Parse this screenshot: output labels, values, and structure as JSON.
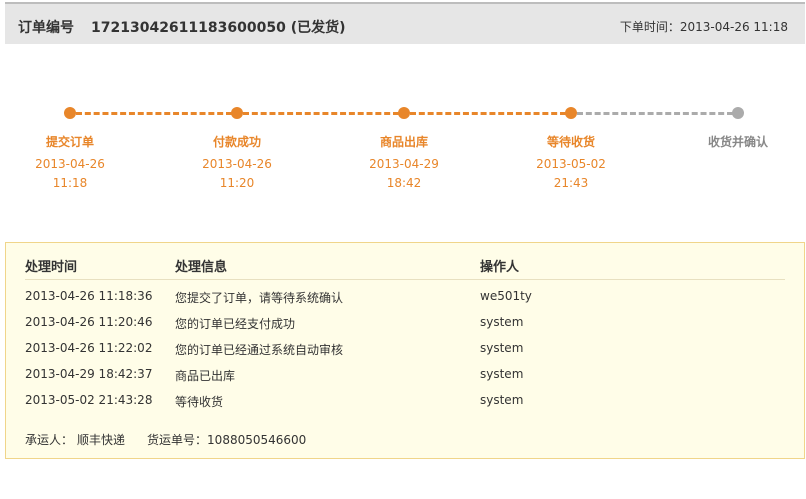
{
  "header": {
    "order_label": "订单编号",
    "order_number": "17213042611183600050",
    "order_status": "(已发货)",
    "order_time_label": "下单时间：",
    "order_time": "2013-04-26 11:18"
  },
  "progress": {
    "steps": [
      {
        "label": "提交订单",
        "date": "2013-04-26",
        "time": "11:18",
        "done": true
      },
      {
        "label": "付款成功",
        "date": "2013-04-26",
        "time": "11:20",
        "done": true
      },
      {
        "label": "商品出库",
        "date": "2013-04-29",
        "time": "18:42",
        "done": true
      },
      {
        "label": "等待收货",
        "date": "2013-05-02",
        "time": "21:43",
        "done": true
      },
      {
        "label": "收货并确认",
        "date": "",
        "time": "",
        "done": false
      }
    ],
    "colors": {
      "done": "#e8862a",
      "pending": "#ababab"
    }
  },
  "log": {
    "headers": {
      "time": "处理时间",
      "info": "处理信息",
      "operator": "操作人"
    },
    "rows": [
      {
        "time": "2013-04-26 11:18:36",
        "info": "您提交了订单，请等待系统确认",
        "operator": "we501ty"
      },
      {
        "time": "2013-04-26 11:20:46",
        "info": "您的订单已经支付成功",
        "operator": "system"
      },
      {
        "time": "2013-04-26 11:22:02",
        "info": "您的订单已经通过系统自动审核",
        "operator": "system"
      },
      {
        "time": "2013-04-29 18:42:37",
        "info": "商品已出库",
        "operator": "system"
      },
      {
        "time": "2013-05-02 21:43:28",
        "info": "等待收货",
        "operator": "system"
      }
    ],
    "carrier_label": "承运人：",
    "carrier": "顺丰快递",
    "tracking_label": "货运单号：",
    "tracking_number": "1088050546600"
  }
}
